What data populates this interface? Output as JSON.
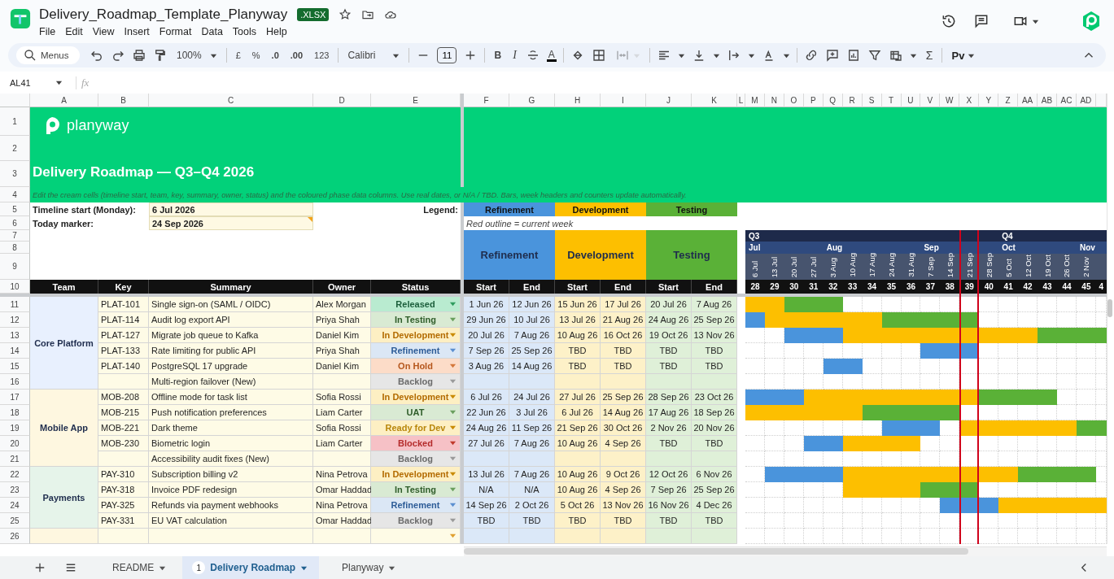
{
  "document": {
    "title": "Delivery_Roadmap_Template_Planyway",
    "badge": ".XLSX"
  },
  "menu": [
    "File",
    "Edit",
    "View",
    "Insert",
    "Format",
    "Data",
    "Tools",
    "Help"
  ],
  "toolbar": {
    "search_placeholder": "Menus",
    "zoom": "100%",
    "currency": "£",
    "percent": "%",
    "decimals_less": ".0",
    "decimals_more": ".00",
    "number_format": "123",
    "font": "Calibri",
    "font_size": "11",
    "bold": "B",
    "italic": "I",
    "text_color": "A",
    "merge_disabled": true,
    "sum": "Σ",
    "addon": "Pv"
  },
  "formula_bar": {
    "cell": "AL41",
    "fx": "fx"
  },
  "column_letters": [
    "A",
    "B",
    "C",
    "D",
    "E",
    "F",
    "G",
    "H",
    "I",
    "J",
    "K",
    "L",
    "M",
    "N",
    "O",
    "P",
    "Q",
    "R",
    "S",
    "T",
    "U",
    "V",
    "W",
    "X",
    "Y",
    "Z",
    "AA",
    "AB",
    "AC",
    "AD"
  ],
  "row_numbers": [
    "1",
    "2",
    "3",
    "4",
    "5",
    "6",
    "7",
    "8",
    "9",
    "10",
    "11",
    "12",
    "13",
    "14",
    "15",
    "16",
    "17",
    "18",
    "19",
    "20",
    "21",
    "22",
    "23",
    "24",
    "25",
    "26"
  ],
  "banner": {
    "brand": "planyway",
    "title": "Delivery Roadmap — Q3–Q4 2026",
    "instructions": "Edit the cream cells (timeline start, team, key, summary, owner, status) and the coloured phase data columns. Use real dates, or N/A / TBD. Bars, week headers and counters update automatically."
  },
  "settings": [
    {
      "label": "Timeline start (Monday):",
      "value": "6 Jul 2026",
      "note": false
    },
    {
      "label": "Today marker:",
      "value": "24 Sep 2026",
      "note": true
    }
  ],
  "legend": {
    "label": "Legend:",
    "items": [
      "Refinement",
      "Development",
      "Testing"
    ],
    "note": "Red outline = current week"
  },
  "phase_headers": [
    "Refinement",
    "Development",
    "Testing"
  ],
  "columns": [
    "Team",
    "Key",
    "Summary",
    "Owner",
    "Status"
  ],
  "phase_columns": [
    "Start",
    "End",
    "Start",
    "End",
    "Start",
    "End"
  ],
  "weeks": [
    {
      "date": "6 Jul",
      "number": "28",
      "current": false,
      "quarter": "Q3",
      "month": "Jul"
    },
    {
      "date": "13 Jul",
      "number": "29",
      "current": false
    },
    {
      "date": "20 Jul",
      "number": "30",
      "current": false
    },
    {
      "date": "27 Jul",
      "number": "31",
      "current": false
    },
    {
      "date": "3 Aug",
      "number": "32",
      "current": false,
      "month": "Aug"
    },
    {
      "date": "10 Aug",
      "number": "33",
      "current": false
    },
    {
      "date": "17 Aug",
      "number": "34",
      "current": false
    },
    {
      "date": "24 Aug",
      "number": "35",
      "current": false
    },
    {
      "date": "31 Aug",
      "number": "36",
      "current": false
    },
    {
      "date": "7 Sep",
      "number": "37",
      "current": false,
      "month": "Sep"
    },
    {
      "date": "14 Sep",
      "number": "38",
      "current": false
    },
    {
      "date": "21 Sep",
      "number": "39",
      "current": true
    },
    {
      "date": "28 Sep",
      "number": "40",
      "current": false
    },
    {
      "date": "5 Oct",
      "number": "41",
      "current": false,
      "quarter": "Q4",
      "month": "Oct"
    },
    {
      "date": "12 Oct",
      "number": "42",
      "current": false
    },
    {
      "date": "19 Oct",
      "number": "43",
      "current": false
    },
    {
      "date": "26 Oct",
      "number": "44",
      "current": false
    },
    {
      "date": "2 Nov",
      "number": "45",
      "current": false,
      "month": "Nov"
    },
    {
      "number": "4",
      "current": false
    }
  ],
  "teams": [
    {
      "name": "Core Platform",
      "color": "#e8f0fe",
      "tasks": [
        {
          "key": "PLAT-101",
          "summary": "Single sign-on (SAML / OIDC)",
          "owner": "Alex Morgan",
          "status": {
            "label": "Released",
            "kind": "released"
          },
          "dates": [
            "1 Jun 26",
            "12 Jun 26",
            "15 Jun 26",
            "17 Jul 26",
            "20 Jul 26",
            "7 Aug 26"
          ],
          "timeline": [
            {
              "kind": "d"
            },
            {
              "kind": "d"
            },
            {
              "kind": "t"
            },
            {
              "kind": "t"
            },
            {
              "kind": "t"
            },
            {
              "kind": "n"
            },
            {
              "kind": "n"
            },
            {
              "kind": "n"
            },
            {
              "kind": "n"
            },
            {
              "kind": "n"
            },
            {
              "kind": "n"
            },
            {
              "kind": "n"
            },
            {
              "kind": "n"
            },
            {
              "kind": "n"
            },
            {
              "kind": "n"
            },
            {
              "kind": "n"
            },
            {
              "kind": "n"
            },
            {
              "kind": "n"
            },
            {
              "kind": "n"
            }
          ]
        },
        {
          "key": "PLAT-114",
          "summary": "Audit log export API",
          "owner": "Priya Shah",
          "status": {
            "label": "In Testing",
            "kind": "testing"
          },
          "dates": [
            "29 Jun 26",
            "10 Jul 26",
            "13 Jul 26",
            "21 Aug 26",
            "24 Aug 26",
            "25 Sep 26"
          ],
          "timeline": [
            {
              "kind": "r"
            },
            {
              "kind": "d"
            },
            {
              "kind": "d"
            },
            {
              "kind": "d"
            },
            {
              "kind": "d"
            },
            {
              "kind": "d"
            },
            {
              "kind": "d"
            },
            {
              "kind": "t"
            },
            {
              "kind": "t"
            },
            {
              "kind": "t"
            },
            {
              "kind": "t"
            },
            {
              "kind": "t"
            },
            {
              "kind": "n"
            },
            {
              "kind": "n"
            },
            {
              "kind": "n"
            },
            {
              "kind": "n"
            },
            {
              "kind": "n"
            },
            {
              "kind": "n"
            },
            {
              "kind": "n"
            }
          ]
        },
        {
          "key": "PLAT-127",
          "summary": "Migrate job queue to Kafka",
          "owner": "Daniel Kim",
          "status": {
            "label": "In Development",
            "kind": "development"
          },
          "dates": [
            "20 Jul 26",
            "7 Aug 26",
            "10 Aug 26",
            "16 Oct 26",
            "19 Oct 26",
            "13 Nov 26"
          ],
          "timeline": [
            {
              "kind": "n"
            },
            {
              "kind": "n"
            },
            {
              "kind": "r"
            },
            {
              "kind": "r"
            },
            {
              "kind": "r"
            },
            {
              "kind": "d"
            },
            {
              "kind": "d"
            },
            {
              "kind": "d"
            },
            {
              "kind": "d"
            },
            {
              "kind": "d"
            },
            {
              "kind": "d"
            },
            {
              "kind": "d"
            },
            {
              "kind": "d"
            },
            {
              "kind": "d"
            },
            {
              "kind": "d"
            },
            {
              "kind": "t"
            },
            {
              "kind": "t"
            },
            {
              "kind": "t"
            },
            {
              "kind": "t"
            }
          ]
        },
        {
          "key": "PLAT-133",
          "summary": "Rate limiting for public API",
          "owner": "Priya Shah",
          "status": {
            "label": "Refinement",
            "kind": "refinement"
          },
          "dates": [
            "7 Sep 26",
            "25 Sep 26",
            "TBD",
            "TBD",
            "TBD",
            "TBD"
          ],
          "timeline": [
            {
              "kind": "n"
            },
            {
              "kind": "n"
            },
            {
              "kind": "n"
            },
            {
              "kind": "n"
            },
            {
              "kind": "n"
            },
            {
              "kind": "n"
            },
            {
              "kind": "n"
            },
            {
              "kind": "n"
            },
            {
              "kind": "n"
            },
            {
              "kind": "r"
            },
            {
              "kind": "r"
            },
            {
              "kind": "r"
            },
            {
              "kind": "n"
            },
            {
              "kind": "n"
            },
            {
              "kind": "n"
            },
            {
              "kind": "n"
            },
            {
              "kind": "n"
            },
            {
              "kind": "n"
            },
            {
              "kind": "n"
            }
          ]
        },
        {
          "key": "PLAT-140",
          "summary": "PostgreSQL 17 upgrade",
          "owner": "Daniel Kim",
          "status": {
            "label": "On Hold",
            "kind": "hold"
          },
          "dates": [
            "3 Aug 26",
            "14 Aug 26",
            "TBD",
            "TBD",
            "TBD",
            "TBD"
          ],
          "timeline": [
            {
              "kind": "n"
            },
            {
              "kind": "n"
            },
            {
              "kind": "n"
            },
            {
              "kind": "n"
            },
            {
              "kind": "r"
            },
            {
              "kind": "r"
            },
            {
              "kind": "n"
            },
            {
              "kind": "n"
            },
            {
              "kind": "n"
            },
            {
              "kind": "n"
            },
            {
              "kind": "n"
            },
            {
              "kind": "n"
            },
            {
              "kind": "n"
            },
            {
              "kind": "n"
            },
            {
              "kind": "n"
            },
            {
              "kind": "n"
            },
            {
              "kind": "n"
            },
            {
              "kind": "n"
            },
            {
              "kind": "n"
            }
          ]
        },
        {
          "summary": "Multi-region failover (New)",
          "status": {
            "label": "Backlog",
            "kind": "backlog"
          }
        }
      ]
    },
    {
      "name": "Mobile App",
      "color": "#fef7e0",
      "tasks": [
        {
          "key": "MOB-208",
          "summary": "Offline mode for task list",
          "owner": "Sofia Rossi",
          "status": {
            "label": "In Development",
            "kind": "development"
          },
          "dates": [
            "6 Jul 26",
            "24 Jul 26",
            "27 Jul 26",
            "25 Sep 26",
            "28 Sep 26",
            "23 Oct 26"
          ],
          "timeline": [
            {
              "kind": "r"
            },
            {
              "kind": "r"
            },
            {
              "kind": "r"
            },
            {
              "kind": "d"
            },
            {
              "kind": "d"
            },
            {
              "kind": "d"
            },
            {
              "kind": "d"
            },
            {
              "kind": "d"
            },
            {
              "kind": "d"
            },
            {
              "kind": "d"
            },
            {
              "kind": "d"
            },
            {
              "kind": "d"
            },
            {
              "kind": "t"
            },
            {
              "kind": "t"
            },
            {
              "kind": "t"
            },
            {
              "kind": "t"
            },
            {
              "kind": "n"
            },
            {
              "kind": "n"
            },
            {
              "kind": "n"
            }
          ]
        },
        {
          "key": "MOB-215",
          "summary": "Push notification preferences",
          "owner": "Liam Carter",
          "status": {
            "label": "UAT",
            "kind": "uat"
          },
          "dates": [
            "22 Jun 26",
            "3 Jul 26",
            "6 Jul 26",
            "14 Aug 26",
            "17 Aug 26",
            "18 Sep 26"
          ],
          "timeline": [
            {
              "kind": "d"
            },
            {
              "kind": "d"
            },
            {
              "kind": "d"
            },
            {
              "kind": "d"
            },
            {
              "kind": "d"
            },
            {
              "kind": "d"
            },
            {
              "kind": "t"
            },
            {
              "kind": "t"
            },
            {
              "kind": "t"
            },
            {
              "kind": "t"
            },
            {
              "kind": "t"
            },
            {
              "kind": "n"
            },
            {
              "kind": "n"
            },
            {
              "kind": "n"
            },
            {
              "kind": "n"
            },
            {
              "kind": "n"
            },
            {
              "kind": "n"
            },
            {
              "kind": "n"
            },
            {
              "kind": "n"
            }
          ]
        },
        {
          "key": "MOB-221",
          "summary": "Dark theme",
          "owner": "Sofia Rossi",
          "status": {
            "label": "Ready for Dev",
            "kind": "ready"
          },
          "dates": [
            "24 Aug 26",
            "11 Sep 26",
            "21 Sep 26",
            "30 Oct 26",
            "2 Nov 26",
            "20 Nov 26"
          ],
          "timeline": [
            {
              "kind": "n"
            },
            {
              "kind": "n"
            },
            {
              "kind": "n"
            },
            {
              "kind": "n"
            },
            {
              "kind": "n"
            },
            {
              "kind": "n"
            },
            {
              "kind": "n"
            },
            {
              "kind": "r"
            },
            {
              "kind": "r"
            },
            {
              "kind": "r"
            },
            {
              "kind": "n"
            },
            {
              "kind": "d"
            },
            {
              "kind": "d"
            },
            {
              "kind": "d"
            },
            {
              "kind": "d"
            },
            {
              "kind": "d"
            },
            {
              "kind": "d"
            },
            {
              "kind": "t"
            },
            {
              "kind": "t"
            }
          ]
        },
        {
          "key": "MOB-230",
          "summary": "Biometric login",
          "owner": "Liam Carter",
          "status": {
            "label": "Blocked",
            "kind": "blocked"
          },
          "dates": [
            "27 Jul 26",
            "7 Aug 26",
            "10 Aug 26",
            "4 Sep 26",
            "TBD",
            "TBD"
          ],
          "timeline": [
            {
              "kind": "n"
            },
            {
              "kind": "n"
            },
            {
              "kind": "n"
            },
            {
              "kind": "r"
            },
            {
              "kind": "r"
            },
            {
              "kind": "d"
            },
            {
              "kind": "d"
            },
            {
              "kind": "d"
            },
            {
              "kind": "d"
            },
            {
              "kind": "n"
            },
            {
              "kind": "n"
            },
            {
              "kind": "n"
            },
            {
              "kind": "n"
            },
            {
              "kind": "n"
            },
            {
              "kind": "n"
            },
            {
              "kind": "n"
            },
            {
              "kind": "n"
            },
            {
              "kind": "n"
            },
            {
              "kind": "n"
            }
          ]
        },
        {
          "summary": "Accessibility audit fixes (New)",
          "status": {
            "label": "Backlog",
            "kind": "backlog"
          }
        }
      ]
    },
    {
      "name": "Payments",
      "color": "#e6f4ea",
      "tasks": [
        {
          "key": "PAY-310",
          "summary": "Subscription billing v2",
          "owner": "Nina Petrova",
          "status": {
            "label": "In Development",
            "kind": "development"
          },
          "dates": [
            "13 Jul 26",
            "7 Aug 26",
            "10 Aug 26",
            "9 Oct 26",
            "12 Oct 26",
            "6 Nov 26"
          ],
          "timeline": [
            {
              "kind": "n"
            },
            {
              "kind": "r"
            },
            {
              "kind": "r"
            },
            {
              "kind": "r"
            },
            {
              "kind": "r"
            },
            {
              "kind": "d"
            },
            {
              "kind": "d"
            },
            {
              "kind": "d"
            },
            {
              "kind": "d"
            },
            {
              "kind": "d"
            },
            {
              "kind": "d"
            },
            {
              "kind": "d"
            },
            {
              "kind": "d"
            },
            {
              "kind": "d"
            },
            {
              "kind": "t"
            },
            {
              "kind": "t"
            },
            {
              "kind": "t"
            },
            {
              "kind": "t"
            },
            {
              "kind": "n"
            }
          ]
        },
        {
          "key": "PAY-318",
          "summary": "Invoice PDF redesign",
          "owner": "Omar Haddad",
          "status": {
            "label": "In Testing",
            "kind": "testing"
          },
          "dates": [
            "N/A",
            "N/A",
            "10 Aug 26",
            "4 Sep 26",
            "7 Sep 26",
            "25 Sep 26"
          ],
          "timeline": [
            {
              "kind": "n"
            },
            {
              "kind": "n"
            },
            {
              "kind": "n"
            },
            {
              "kind": "n"
            },
            {
              "kind": "n"
            },
            {
              "kind": "d"
            },
            {
              "kind": "d"
            },
            {
              "kind": "d"
            },
            {
              "kind": "d"
            },
            {
              "kind": "t"
            },
            {
              "kind": "t"
            },
            {
              "kind": "t"
            },
            {
              "kind": "n"
            },
            {
              "kind": "n"
            },
            {
              "kind": "n"
            },
            {
              "kind": "n"
            },
            {
              "kind": "n"
            },
            {
              "kind": "n"
            },
            {
              "kind": "n"
            }
          ]
        },
        {
          "key": "PAY-325",
          "summary": "Refunds via payment webhooks",
          "owner": "Nina Petrova",
          "status": {
            "label": "Refinement",
            "kind": "refinement"
          },
          "dates": [
            "14 Sep 26",
            "2 Oct 26",
            "5 Oct 26",
            "13 Nov 26",
            "16 Nov 26",
            "4 Dec 26"
          ],
          "timeline": [
            {
              "kind": "n"
            },
            {
              "kind": "n"
            },
            {
              "kind": "n"
            },
            {
              "kind": "n"
            },
            {
              "kind": "n"
            },
            {
              "kind": "n"
            },
            {
              "kind": "n"
            },
            {
              "kind": "n"
            },
            {
              "kind": "n"
            },
            {
              "kind": "n"
            },
            {
              "kind": "r"
            },
            {
              "kind": "r"
            },
            {
              "kind": "r"
            },
            {
              "kind": "d"
            },
            {
              "kind": "d"
            },
            {
              "kind": "d"
            },
            {
              "kind": "d"
            },
            {
              "kind": "d"
            },
            {
              "kind": "d"
            }
          ]
        },
        {
          "key": "PAY-331",
          "summary": "EU VAT calculation",
          "owner": "Omar Haddad",
          "status": {
            "label": "Backlog",
            "kind": "backlog"
          },
          "dates": [
            "TBD",
            "TBD",
            "TBD",
            "TBD",
            "TBD",
            "TBD"
          ]
        }
      ]
    },
    {
      "color": "#fef7e0",
      "tasks": [
        {
          "status": {
            "kind": "empty"
          }
        }
      ]
    }
  ],
  "sheets": [
    {
      "name": "README",
      "selected": false
    },
    {
      "name": "Delivery Roadmap",
      "badge": "1",
      "selected": true
    },
    {
      "name": "Planyway",
      "selected": false
    }
  ]
}
